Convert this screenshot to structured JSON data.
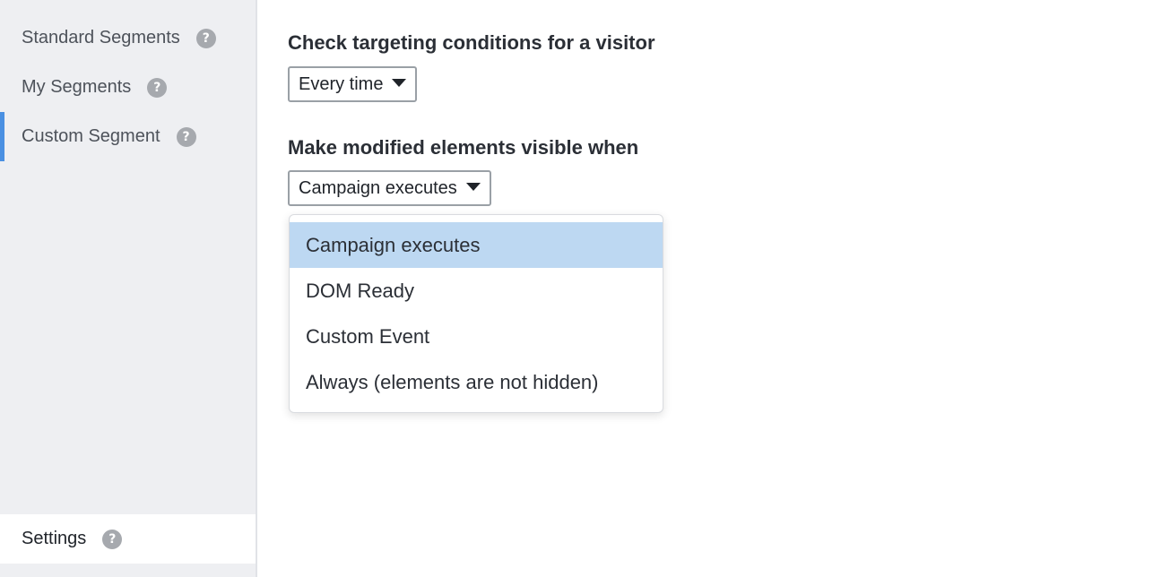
{
  "sidebar": {
    "items": [
      {
        "label": "Standard Segments",
        "help": "?"
      },
      {
        "label": "My Segments",
        "help": "?"
      },
      {
        "label": "Custom Segment",
        "help": "?"
      }
    ],
    "settings": {
      "label": "Settings",
      "help": "?"
    }
  },
  "main": {
    "targeting": {
      "label": "Check targeting conditions for a visitor",
      "selected": "Every time"
    },
    "visibility": {
      "label": "Make modified elements visible when",
      "selected": "Campaign executes",
      "options": [
        "Campaign executes",
        "DOM Ready",
        "Custom Event",
        "Always (elements are not hidden)"
      ]
    }
  },
  "colors": {
    "accent": "#4a90e2",
    "highlight": "#bdd8f2",
    "sidebar_bg": "#eeeff2"
  }
}
